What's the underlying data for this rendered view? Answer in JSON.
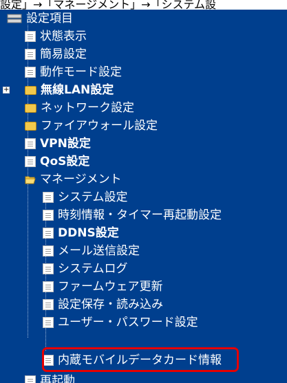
{
  "top_text": "設定」→「マネージメント」→「システム設",
  "root_label": "設定項目",
  "items": [
    {
      "label": "状態表示",
      "icon": "document-icon"
    },
    {
      "label": "簡易設定",
      "icon": "document-icon"
    },
    {
      "label": "動作モード設定",
      "icon": "document-icon"
    },
    {
      "label": "無線LAN設定",
      "icon": "folder-icon",
      "expander": "+"
    },
    {
      "label": "ネットワーク設定",
      "icon": "folder-icon"
    },
    {
      "label": "ファイアウォール設定",
      "icon": "folder-icon"
    },
    {
      "label": "VPN設定",
      "icon": "document-icon"
    },
    {
      "label": "QoS設定",
      "icon": "document-icon"
    },
    {
      "label": "マネージメント",
      "icon": "open-folder-icon"
    },
    {
      "label": "システム設定",
      "icon": "document-icon"
    },
    {
      "label": "時刻情報・タイマー再起動設定",
      "icon": "document-icon"
    },
    {
      "label": "DDNS設定",
      "icon": "document-icon"
    },
    {
      "label": "メール送信設定",
      "icon": "document-icon"
    },
    {
      "label": "システムログ",
      "icon": "document-icon"
    },
    {
      "label": "ファームウェア更新",
      "icon": "document-icon"
    },
    {
      "label": "設定保存・読み込み",
      "icon": "document-icon"
    },
    {
      "label": "ユーザー・パスワード設定",
      "icon": "document-icon"
    },
    {
      "label": "内蔵モバイルデータカード情報",
      "icon": "document-icon"
    },
    {
      "label": "再起動",
      "icon": "document-icon"
    }
  ],
  "colors": {
    "background": "#003f8e",
    "highlight": "#e60000"
  }
}
